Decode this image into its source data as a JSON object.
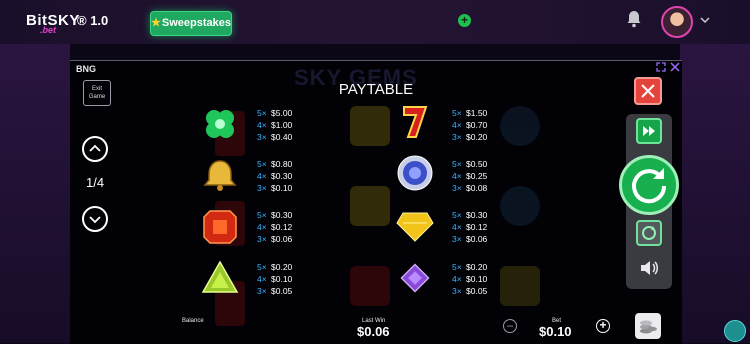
{
  "header": {
    "logo_text": "BitSKY",
    "logo_sub": ".bet",
    "logo_version": "® 1.0",
    "sweepstakes_label": "Sweepstakes",
    "add_funds_label": "+"
  },
  "game": {
    "provider": "BNG",
    "exit_label_1": "Exit",
    "exit_label_2": "Game",
    "background_title": "SKY GEMS",
    "paytable_title": "PAYTABLE",
    "page_indicator": "1/4",
    "symbols": [
      {
        "icon": "clover-gem-icon",
        "pays": [
          {
            "m": "5×",
            "v": "$5.00"
          },
          {
            "m": "4×",
            "v": "$1.00"
          },
          {
            "m": "3×",
            "v": "$0.40"
          }
        ]
      },
      {
        "icon": "seven-icon",
        "pays": [
          {
            "m": "5×",
            "v": "$1.50"
          },
          {
            "m": "4×",
            "v": "$0.70"
          },
          {
            "m": "3×",
            "v": "$0.20"
          }
        ]
      },
      {
        "icon": "bell-icon",
        "pays": [
          {
            "m": "5×",
            "v": "$0.80"
          },
          {
            "m": "4×",
            "v": "$0.30"
          },
          {
            "m": "3×",
            "v": "$0.10"
          }
        ]
      },
      {
        "icon": "blue-gem-icon",
        "pays": [
          {
            "m": "5×",
            "v": "$0.50"
          },
          {
            "m": "4×",
            "v": "$0.25"
          },
          {
            "m": "3×",
            "v": "$0.08"
          }
        ]
      },
      {
        "icon": "red-gem-icon",
        "pays": [
          {
            "m": "5×",
            "v": "$0.30"
          },
          {
            "m": "4×",
            "v": "$0.12"
          },
          {
            "m": "3×",
            "v": "$0.06"
          }
        ]
      },
      {
        "icon": "yellow-gem-icon",
        "pays": [
          {
            "m": "5×",
            "v": "$0.30"
          },
          {
            "m": "4×",
            "v": "$0.12"
          },
          {
            "m": "3×",
            "v": "$0.06"
          }
        ]
      },
      {
        "icon": "green-triangle-gem-icon",
        "pays": [
          {
            "m": "5×",
            "v": "$0.20"
          },
          {
            "m": "4×",
            "v": "$0.10"
          },
          {
            "m": "3×",
            "v": "$0.05"
          }
        ]
      },
      {
        "icon": "purple-gem-icon",
        "pays": [
          {
            "m": "5×",
            "v": "$0.20"
          },
          {
            "m": "4×",
            "v": "$0.10"
          },
          {
            "m": "3×",
            "v": "$0.05"
          }
        ]
      }
    ],
    "balance_label": "Balance",
    "last_win_label": "Last Win",
    "last_win_value": "$0.06",
    "bet_label": "Bet",
    "bet_value": "$0.10",
    "bet_minus": "−",
    "bet_plus": "+"
  },
  "colors": {
    "accent_green": "#18b04f",
    "multiplier_blue": "#37b4ff",
    "close_red": "#e4443b",
    "sweepstakes_green": "#1fa860"
  }
}
